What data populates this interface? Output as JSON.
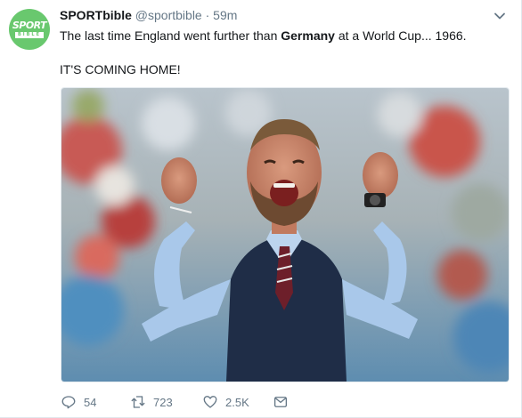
{
  "tweet": {
    "author_name": "SPORTbible",
    "author_handle": "@sportbible",
    "separator": "·",
    "time": "59m",
    "text_line1": {
      "before": "The last time England went further than ",
      "bold": "Germany",
      "after": " at a World Cup... 1966."
    },
    "text_line2": "IT'S COMING HOME!",
    "avatar": {
      "word1": "SPORT",
      "word2": "BIBLE",
      "color": "#69c86e"
    }
  },
  "actions": {
    "reply_count": "54",
    "retweet_count": "723",
    "like_count": "2.5K"
  },
  "icons": {
    "caret": "chevron-down-icon",
    "reply": "reply-icon",
    "retweet": "retweet-icon",
    "like": "heart-icon",
    "dm": "envelope-icon"
  },
  "colors": {
    "muted": "#657786",
    "text": "#14171a",
    "brand_green": "#69c86e"
  }
}
